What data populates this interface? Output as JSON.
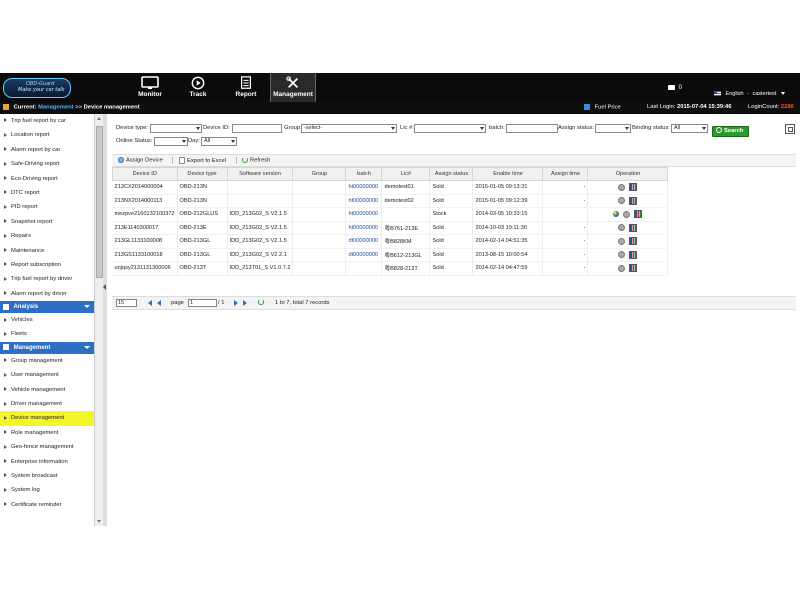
{
  "app": {
    "logo_line1": "OBD-Guard",
    "logo_line2": "Make your car talk"
  },
  "nav": [
    {
      "label": "Monitor",
      "icon": "monitor-icon"
    },
    {
      "label": "Track",
      "icon": "play-icon"
    },
    {
      "label": "Report",
      "icon": "report-icon"
    },
    {
      "label": "Management",
      "icon": "tools-icon"
    }
  ],
  "header": {
    "camera_count": "0",
    "language": "English",
    "user": "castertest",
    "separator": "-"
  },
  "breadcrumb": {
    "current_label": "Current:",
    "section": "Management",
    "arrow": ">>",
    "page": "Device management"
  },
  "status": {
    "fuel_price": "Fuel Price",
    "last_login_label": "Last Login:",
    "last_login_value": "2015-07-04 15:39:46",
    "login_count_label": "LoginCount:",
    "login_count_value": "2286"
  },
  "sidebar": {
    "report_items": [
      "Trip fuel report by car",
      "Location report",
      "Alarm report by car",
      "Safe-Driving report",
      "Eco-Driving report",
      "DTC report",
      "PID report",
      "Snapshot report",
      "Repairs",
      "Maintenance",
      "Report subscription",
      "Trip fuel report by driver",
      "Alarm report by driver"
    ],
    "analysis_title": "Analysis",
    "analysis_items": [
      "Vehicles",
      "Fleets"
    ],
    "management_title": "Management",
    "management_items": [
      "Group management",
      "User management",
      "Vehicle management",
      "Driver management",
      "Device management",
      "Role management",
      "Geo-fence management",
      "Enterprise information",
      "System broadcast",
      "System log",
      "Certificate reminder"
    ],
    "selected": "Device management"
  },
  "filters": {
    "device_type_label": "Device type:",
    "device_type_value": "",
    "device_id_label": "Device ID:",
    "device_id_value": "",
    "group_label": "Group:",
    "group_value": "-select-",
    "lic_label": "Lic #:",
    "lic_value": "",
    "batch_label": "batch:",
    "batch_value": "",
    "assign_status_label": "Assign status:",
    "assign_status_value": "",
    "binding_status_label": "Binding status:",
    "binding_status_value": "All",
    "search_label": "Search",
    "online_status_label": "Online Status:",
    "online_status_value": "",
    "day_label": "Day:",
    "day_value": "All"
  },
  "toolbar": {
    "assign_device": "Assign Device",
    "export_excel": "Export to Excel",
    "refresh": "Refresh"
  },
  "table": {
    "columns": [
      "Device ID",
      "Device type",
      "Software version",
      "Group",
      "batch",
      "Lic#",
      "Assign status",
      "Enable time",
      "Assign time",
      "Operation"
    ],
    "rows": [
      {
        "device_id": "213CX2014000004",
        "device_type": "OBD-213N",
        "software": "",
        "group": "",
        "batch": "ht00000000",
        "lic": "demotest01",
        "assign_status": "Sold",
        "enable_time": "2015-01-05 09:13:31",
        "assign_time": "-",
        "ops": [
          "gear",
          "chart"
        ]
      },
      {
        "device_id": "213NX2014000113",
        "device_type": "OBD-213N",
        "software": "",
        "group": "",
        "batch": "ht00000000",
        "lic": "demotest02",
        "assign_status": "Sold",
        "enable_time": "2015-01-05 09:12:39",
        "assign_time": "-",
        "ops": [
          "gear",
          "chart"
        ]
      },
      {
        "device_id": "mezpve2160132100372",
        "device_type": "OBD-212GLUS",
        "software": "IDD_213G02_S V2.1.5",
        "group": "",
        "batch": "ht00000000",
        "lic": "",
        "assign_status": "Stock",
        "enable_time": "2014-03-05 10:33:15",
        "assign_time": "",
        "ops": [
          "globe",
          "gear",
          "chart"
        ]
      },
      {
        "device_id": "213E1140300017",
        "device_type": "OBD-213E",
        "software": "IDD_213G02_S V2.1.5",
        "group": "",
        "batch": "ht00000000",
        "lic": "粤B761-213E",
        "assign_status": "Sold",
        "enable_time": "2014-10-03 19:11:30",
        "assign_time": "-",
        "ops": [
          "gear",
          "chart"
        ]
      },
      {
        "device_id": "213GL1133100008",
        "device_type": "OBD-213GL",
        "software": "IDD_213G02_S V2.1.5",
        "group": "",
        "batch": "dt00000000",
        "lic": "粤B828KM",
        "assign_status": "Sold",
        "enable_time": "2014-02-14 04:51:35",
        "assign_time": "-",
        "ops": [
          "gear",
          "chart"
        ]
      },
      {
        "device_id": "213GS1133100018",
        "device_type": "OBD-213GL",
        "software": "IDD_213G02_S V2.2.1",
        "group": "",
        "batch": "dt00000000",
        "lic": "粤B612-213GL",
        "assign_status": "Sold",
        "enable_time": "2013-08-15 10:00:54",
        "assign_time": "-",
        "ops": [
          "gear",
          "chart"
        ]
      },
      {
        "device_id": "unjqsy2131131300006",
        "device_type": "OBD-213T",
        "software": "IDD_213T01_S V1.0.7.2",
        "group": "",
        "batch": "",
        "lic": "粤B828-213T",
        "assign_status": "Sold",
        "enable_time": "2014-02-14 04:47:59",
        "assign_time": "-",
        "ops": [
          "gear",
          "chart"
        ]
      }
    ]
  },
  "pager": {
    "page_size": "15",
    "page_label": "page",
    "page_value": "1",
    "of_total": "/ 1",
    "summary": "1 to 7, total 7 records"
  },
  "colors": {
    "accent_blue": "#2c6fc4",
    "search_green": "#2e9a2e",
    "login_count_red": "#ff4a2a",
    "selected_yellow": "#f2f52a"
  }
}
